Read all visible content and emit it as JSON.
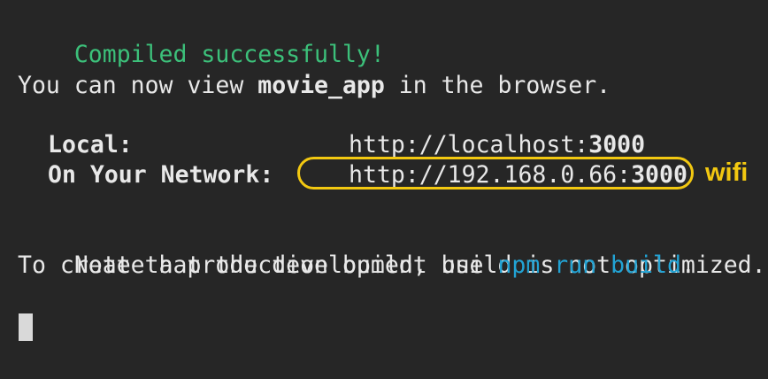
{
  "terminal": {
    "line1": "Compiled successfully!",
    "line2_prefix": "You can now view ",
    "line2_app": "movie_app",
    "line2_suffix": " in the browser.",
    "local_label": "Local:",
    "local_url_prefix": "http://localhost:",
    "local_port": "3000",
    "network_label": "On Your Network:",
    "network_url_prefix": "http://192.168.0.66:",
    "network_port": "3000",
    "note_line": "Note that the development build is not optimized.",
    "prod_prefix": "To create a production build, use ",
    "prod_cmd_npm": "npm",
    "prod_cmd_run": "run",
    "prod_cmd_build": "build",
    "prod_suffix": "."
  },
  "annotation": {
    "label": "wifi",
    "color": "#f2c811"
  },
  "colors": {
    "background": "#262626",
    "success": "#3cc07a",
    "command": "#22a3d4",
    "text": "#e8e8e8"
  }
}
